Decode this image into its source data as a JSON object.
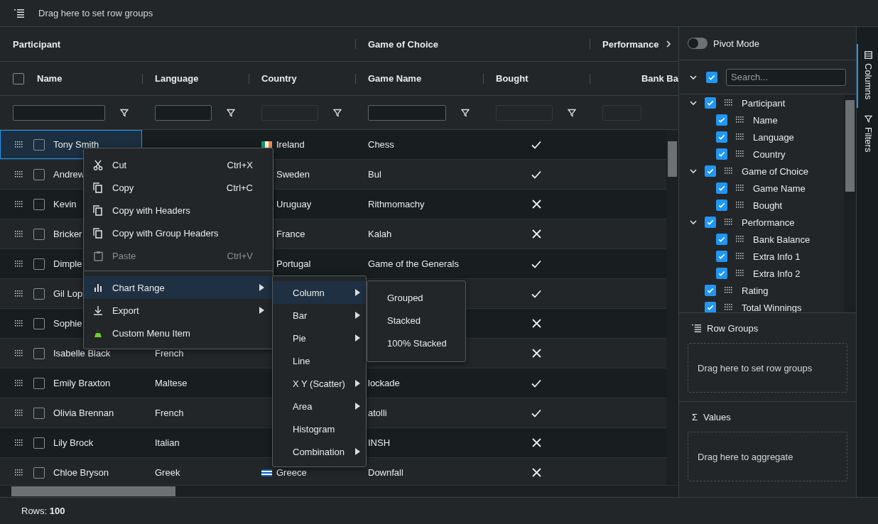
{
  "row_group_bar": {
    "placeholder": "Drag here to set row groups"
  },
  "grid": {
    "column_groups": [
      {
        "label": "Participant",
        "columns": [
          {
            "label": "Name",
            "filter": {
              "disabled": false
            }
          },
          {
            "label": "Language",
            "filter": {
              "disabled": false
            }
          },
          {
            "label": "Country",
            "filter": {
              "disabled": true
            }
          }
        ]
      },
      {
        "label": "Game of Choice",
        "columns": [
          {
            "label": "Game Name",
            "filter": {
              "disabled": false
            }
          },
          {
            "label": "Bought",
            "filter": {
              "disabled": true
            }
          }
        ]
      },
      {
        "label": "Performance",
        "expanded": false,
        "columns": [
          {
            "label": "Bank Ba",
            "filter": {
              "disabled": true
            }
          }
        ]
      }
    ],
    "select_all": {
      "checked": false
    },
    "rows": [
      {
        "name": "Tony Smith",
        "checked": false,
        "focused": true,
        "country": "Ireland",
        "flag": {
          "kind": "vertical-stripes",
          "stripes": [
            {
              "color": "#169b62"
            },
            {
              "color": "#ffffff"
            },
            {
              "color": "#ff883e"
            }
          ]
        },
        "game": "Chess",
        "bought": true
      },
      {
        "name": "Andrew",
        "checked": false,
        "focused": false,
        "country": "Sweden",
        "game": "Bul",
        "bought": true
      },
      {
        "name": "Kevin",
        "checked": false,
        "focused": false,
        "country": "Uruguay",
        "game": "Rithmomachy",
        "bought": false
      },
      {
        "name": "Bricker",
        "checked": false,
        "focused": false,
        "country": "France",
        "game": "Kalah",
        "bought": false
      },
      {
        "name": "Dimple",
        "checked": false,
        "focused": false,
        "country": "Portugal",
        "game": "Game of the Generals",
        "bought": true
      },
      {
        "name": "Gil Lop",
        "checked": false,
        "focused": false,
        "bought": true
      },
      {
        "name": "Sophie",
        "checked": false,
        "focused": false,
        "bought": false
      },
      {
        "name": "Isabelle Black",
        "checked": false,
        "focused": false,
        "language": "French",
        "bought": false
      },
      {
        "name": "Emily Braxton",
        "checked": false,
        "focused": false,
        "language": "Maltese",
        "game": "lockade",
        "bought": true
      },
      {
        "name": "Olivia Brennan",
        "checked": false,
        "focused": false,
        "language": "French",
        "game": "atolli",
        "bought": true
      },
      {
        "name": "Lily Brock",
        "checked": false,
        "focused": false,
        "language": "Italian",
        "game": "INSH",
        "bought": false
      },
      {
        "name": "Chloe Bryson",
        "checked": false,
        "focused": false,
        "language": "Greek",
        "country": "Greece",
        "flag": {
          "kind": "horizontal-stripes",
          "stripes": [
            {
              "color": "#0d5eaf"
            },
            {
              "color": "#ffffff"
            },
            {
              "color": "#0d5eaf"
            },
            {
              "color": "#ffffff"
            },
            {
              "color": "#0d5eaf"
            }
          ]
        },
        "game": "Downfall",
        "bought": false
      }
    ]
  },
  "context_menu": {
    "items": [
      {
        "kind": "cut",
        "label": "Cut",
        "shortcut": "Ctrl+X",
        "disabled": false,
        "active": false,
        "submenu": false
      },
      {
        "kind": "copy",
        "label": "Copy",
        "shortcut": "Ctrl+C",
        "disabled": false,
        "active": false,
        "submenu": false
      },
      {
        "kind": "copy",
        "label": "Copy with Headers",
        "disabled": false,
        "active": false,
        "submenu": false
      },
      {
        "kind": "copy",
        "label": "Copy with Group Headers",
        "disabled": false,
        "active": false,
        "submenu": false
      },
      {
        "kind": "paste",
        "label": "Paste",
        "shortcut": "Ctrl+V",
        "disabled": true,
        "active": false,
        "submenu": false
      },
      {
        "kind": "separator"
      },
      {
        "kind": "chart",
        "label": "Chart Range",
        "disabled": false,
        "active": true,
        "submenu": true
      },
      {
        "kind": "export",
        "label": "Export",
        "disabled": false,
        "active": false,
        "submenu": true
      },
      {
        "kind": "custom",
        "label": "Custom Menu Item",
        "disabled": false,
        "active": false,
        "submenu": false
      }
    ]
  },
  "chart_menu": {
    "items": [
      {
        "label": "Column",
        "active": true,
        "submenu": true
      },
      {
        "label": "Bar",
        "active": false,
        "submenu": true
      },
      {
        "label": "Pie",
        "active": false,
        "submenu": true
      },
      {
        "label": "Line",
        "active": false,
        "submenu": false
      },
      {
        "label": "X Y (Scatter)",
        "active": false,
        "submenu": true
      },
      {
        "label": "Area",
        "active": false,
        "submenu": true
      },
      {
        "label": "Histogram",
        "active": false,
        "submenu": false
      },
      {
        "label": "Combination",
        "active": false,
        "submenu": true
      }
    ]
  },
  "column_menu": {
    "items": [
      {
        "label": "Grouped"
      },
      {
        "label": "Stacked"
      },
      {
        "label": "100% Stacked"
      }
    ]
  },
  "side_panel": {
    "pivot_mode": {
      "label": "Pivot Mode",
      "on": false
    },
    "expanded": true,
    "all_checked": true,
    "search": {
      "placeholder": "Search..."
    },
    "columns": [
      {
        "label": "Participant",
        "checked": true,
        "expanded": true,
        "children": [
          {
            "label": "Name",
            "checked": true
          },
          {
            "label": "Language",
            "checked": true
          },
          {
            "label": "Country",
            "checked": true
          }
        ]
      },
      {
        "label": "Game of Choice",
        "checked": true,
        "expanded": true,
        "children": [
          {
            "label": "Game Name",
            "checked": true
          },
          {
            "label": "Bought",
            "checked": true
          }
        ]
      },
      {
        "label": "Performance",
        "checked": true,
        "expanded": true,
        "children": [
          {
            "label": "Bank Balance",
            "checked": true
          },
          {
            "label": "Extra Info 1",
            "checked": true
          },
          {
            "label": "Extra Info 2",
            "checked": true
          }
        ]
      },
      {
        "label": "Rating",
        "checked": true
      },
      {
        "label": "Total Winnings",
        "checked": true
      }
    ],
    "row_groups": {
      "title": "Row Groups",
      "placeholder": "Drag here to set row groups"
    },
    "values": {
      "icon": "Σ",
      "title": "Values",
      "placeholder": "Drag here to aggregate"
    }
  },
  "side_tabs": [
    {
      "kind": "columns",
      "label": "Columns",
      "selected": true
    },
    {
      "kind": "filters",
      "label": "Filters",
      "selected": false
    }
  ],
  "status_bar": {
    "text": "Rows: **100**"
  }
}
